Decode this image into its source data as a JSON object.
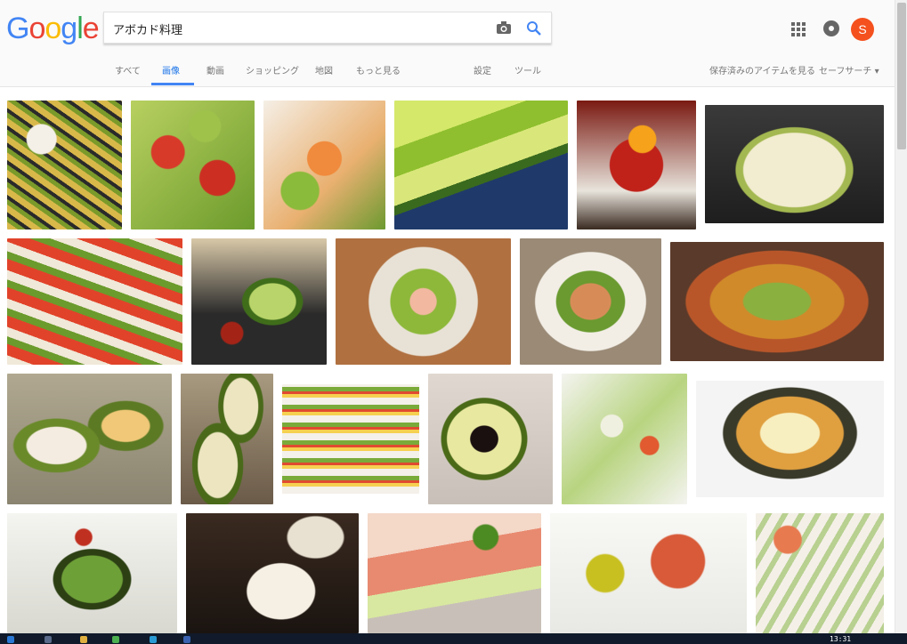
{
  "search": {
    "query": "アボカド料理"
  },
  "header": {
    "avatar_letter": "S"
  },
  "tabs": [
    {
      "label": "すべて",
      "active": false
    },
    {
      "label": "画像",
      "active": true
    },
    {
      "label": "動画",
      "active": false
    },
    {
      "label": "ショッピング",
      "active": false
    },
    {
      "label": "地図",
      "active": false
    },
    {
      "label": "もっと見る",
      "active": false
    }
  ],
  "tools": {
    "settings": "設定",
    "tools": "ツール"
  },
  "right_links": {
    "saved": "保存済みのアイテムを見る",
    "safesearch": "セーフサーチ ▾"
  },
  "taskbar": {
    "clock": "13:31"
  },
  "colors": {
    "google_blue": "#4285f4",
    "google_red": "#ea4335",
    "google_yellow": "#fbbc05",
    "google_green": "#34a853",
    "avatar": "#f4511e"
  },
  "images": [
    {
      "desc": "avocado fries"
    },
    {
      "desc": "tomato avocado salad"
    },
    {
      "desc": "salmon avocado poke"
    },
    {
      "desc": "sliced avocado plate"
    },
    {
      "desc": "tuna yolk avocado bowl"
    },
    {
      "desc": "avocado carbonara"
    },
    {
      "desc": "tomato avocado gratin"
    },
    {
      "desc": "avocado tempura"
    },
    {
      "desc": "avocado salad plate"
    },
    {
      "desc": "shrimp avocado salad"
    },
    {
      "desc": "avocado ajillo"
    },
    {
      "desc": "baked egg avocado"
    },
    {
      "desc": "avocado cheese bake"
    },
    {
      "desc": "avocado sandwich"
    },
    {
      "desc": "avocado soy sauce"
    },
    {
      "desc": "avocado tofu salad"
    },
    {
      "desc": "avocado gratin"
    },
    {
      "desc": "stuffed avocado salad"
    },
    {
      "desc": "avocado dinner table"
    },
    {
      "desc": "prosciutto avocado"
    },
    {
      "desc": "tuna avocado bowl"
    },
    {
      "desc": "avocado spring rolls"
    }
  ]
}
